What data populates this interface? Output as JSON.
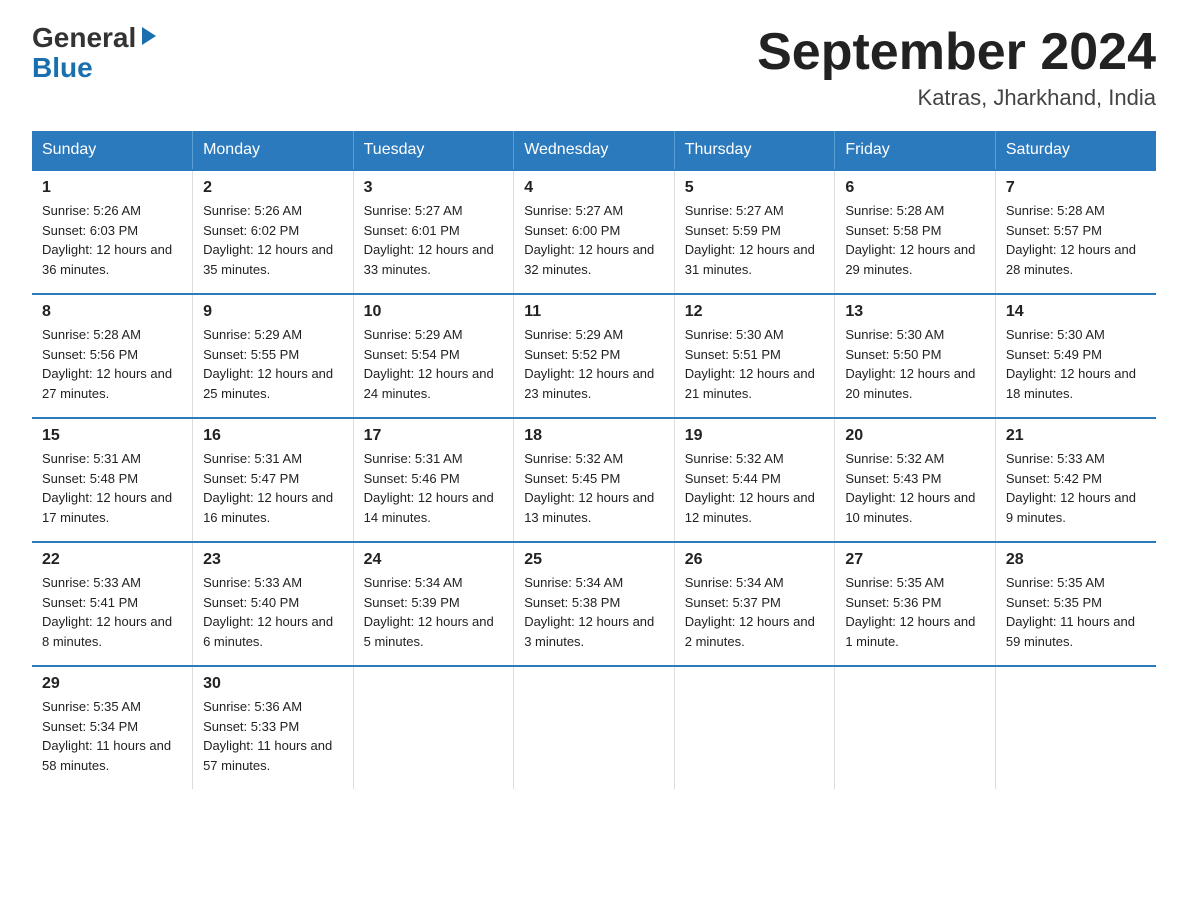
{
  "logo": {
    "general": "General",
    "blue": "Blue",
    "arrow": "▶"
  },
  "title": {
    "month_year": "September 2024",
    "location": "Katras, Jharkhand, India"
  },
  "weekdays": [
    "Sunday",
    "Monday",
    "Tuesday",
    "Wednesday",
    "Thursday",
    "Friday",
    "Saturday"
  ],
  "weeks": [
    [
      {
        "day": "1",
        "sunrise": "Sunrise: 5:26 AM",
        "sunset": "Sunset: 6:03 PM",
        "daylight": "Daylight: 12 hours and 36 minutes."
      },
      {
        "day": "2",
        "sunrise": "Sunrise: 5:26 AM",
        "sunset": "Sunset: 6:02 PM",
        "daylight": "Daylight: 12 hours and 35 minutes."
      },
      {
        "day": "3",
        "sunrise": "Sunrise: 5:27 AM",
        "sunset": "Sunset: 6:01 PM",
        "daylight": "Daylight: 12 hours and 33 minutes."
      },
      {
        "day": "4",
        "sunrise": "Sunrise: 5:27 AM",
        "sunset": "Sunset: 6:00 PM",
        "daylight": "Daylight: 12 hours and 32 minutes."
      },
      {
        "day": "5",
        "sunrise": "Sunrise: 5:27 AM",
        "sunset": "Sunset: 5:59 PM",
        "daylight": "Daylight: 12 hours and 31 minutes."
      },
      {
        "day": "6",
        "sunrise": "Sunrise: 5:28 AM",
        "sunset": "Sunset: 5:58 PM",
        "daylight": "Daylight: 12 hours and 29 minutes."
      },
      {
        "day": "7",
        "sunrise": "Sunrise: 5:28 AM",
        "sunset": "Sunset: 5:57 PM",
        "daylight": "Daylight: 12 hours and 28 minutes."
      }
    ],
    [
      {
        "day": "8",
        "sunrise": "Sunrise: 5:28 AM",
        "sunset": "Sunset: 5:56 PM",
        "daylight": "Daylight: 12 hours and 27 minutes."
      },
      {
        "day": "9",
        "sunrise": "Sunrise: 5:29 AM",
        "sunset": "Sunset: 5:55 PM",
        "daylight": "Daylight: 12 hours and 25 minutes."
      },
      {
        "day": "10",
        "sunrise": "Sunrise: 5:29 AM",
        "sunset": "Sunset: 5:54 PM",
        "daylight": "Daylight: 12 hours and 24 minutes."
      },
      {
        "day": "11",
        "sunrise": "Sunrise: 5:29 AM",
        "sunset": "Sunset: 5:52 PM",
        "daylight": "Daylight: 12 hours and 23 minutes."
      },
      {
        "day": "12",
        "sunrise": "Sunrise: 5:30 AM",
        "sunset": "Sunset: 5:51 PM",
        "daylight": "Daylight: 12 hours and 21 minutes."
      },
      {
        "day": "13",
        "sunrise": "Sunrise: 5:30 AM",
        "sunset": "Sunset: 5:50 PM",
        "daylight": "Daylight: 12 hours and 20 minutes."
      },
      {
        "day": "14",
        "sunrise": "Sunrise: 5:30 AM",
        "sunset": "Sunset: 5:49 PM",
        "daylight": "Daylight: 12 hours and 18 minutes."
      }
    ],
    [
      {
        "day": "15",
        "sunrise": "Sunrise: 5:31 AM",
        "sunset": "Sunset: 5:48 PM",
        "daylight": "Daylight: 12 hours and 17 minutes."
      },
      {
        "day": "16",
        "sunrise": "Sunrise: 5:31 AM",
        "sunset": "Sunset: 5:47 PM",
        "daylight": "Daylight: 12 hours and 16 minutes."
      },
      {
        "day": "17",
        "sunrise": "Sunrise: 5:31 AM",
        "sunset": "Sunset: 5:46 PM",
        "daylight": "Daylight: 12 hours and 14 minutes."
      },
      {
        "day": "18",
        "sunrise": "Sunrise: 5:32 AM",
        "sunset": "Sunset: 5:45 PM",
        "daylight": "Daylight: 12 hours and 13 minutes."
      },
      {
        "day": "19",
        "sunrise": "Sunrise: 5:32 AM",
        "sunset": "Sunset: 5:44 PM",
        "daylight": "Daylight: 12 hours and 12 minutes."
      },
      {
        "day": "20",
        "sunrise": "Sunrise: 5:32 AM",
        "sunset": "Sunset: 5:43 PM",
        "daylight": "Daylight: 12 hours and 10 minutes."
      },
      {
        "day": "21",
        "sunrise": "Sunrise: 5:33 AM",
        "sunset": "Sunset: 5:42 PM",
        "daylight": "Daylight: 12 hours and 9 minutes."
      }
    ],
    [
      {
        "day": "22",
        "sunrise": "Sunrise: 5:33 AM",
        "sunset": "Sunset: 5:41 PM",
        "daylight": "Daylight: 12 hours and 8 minutes."
      },
      {
        "day": "23",
        "sunrise": "Sunrise: 5:33 AM",
        "sunset": "Sunset: 5:40 PM",
        "daylight": "Daylight: 12 hours and 6 minutes."
      },
      {
        "day": "24",
        "sunrise": "Sunrise: 5:34 AM",
        "sunset": "Sunset: 5:39 PM",
        "daylight": "Daylight: 12 hours and 5 minutes."
      },
      {
        "day": "25",
        "sunrise": "Sunrise: 5:34 AM",
        "sunset": "Sunset: 5:38 PM",
        "daylight": "Daylight: 12 hours and 3 minutes."
      },
      {
        "day": "26",
        "sunrise": "Sunrise: 5:34 AM",
        "sunset": "Sunset: 5:37 PM",
        "daylight": "Daylight: 12 hours and 2 minutes."
      },
      {
        "day": "27",
        "sunrise": "Sunrise: 5:35 AM",
        "sunset": "Sunset: 5:36 PM",
        "daylight": "Daylight: 12 hours and 1 minute."
      },
      {
        "day": "28",
        "sunrise": "Sunrise: 5:35 AM",
        "sunset": "Sunset: 5:35 PM",
        "daylight": "Daylight: 11 hours and 59 minutes."
      }
    ],
    [
      {
        "day": "29",
        "sunrise": "Sunrise: 5:35 AM",
        "sunset": "Sunset: 5:34 PM",
        "daylight": "Daylight: 11 hours and 58 minutes."
      },
      {
        "day": "30",
        "sunrise": "Sunrise: 5:36 AM",
        "sunset": "Sunset: 5:33 PM",
        "daylight": "Daylight: 11 hours and 57 minutes."
      },
      null,
      null,
      null,
      null,
      null
    ]
  ]
}
